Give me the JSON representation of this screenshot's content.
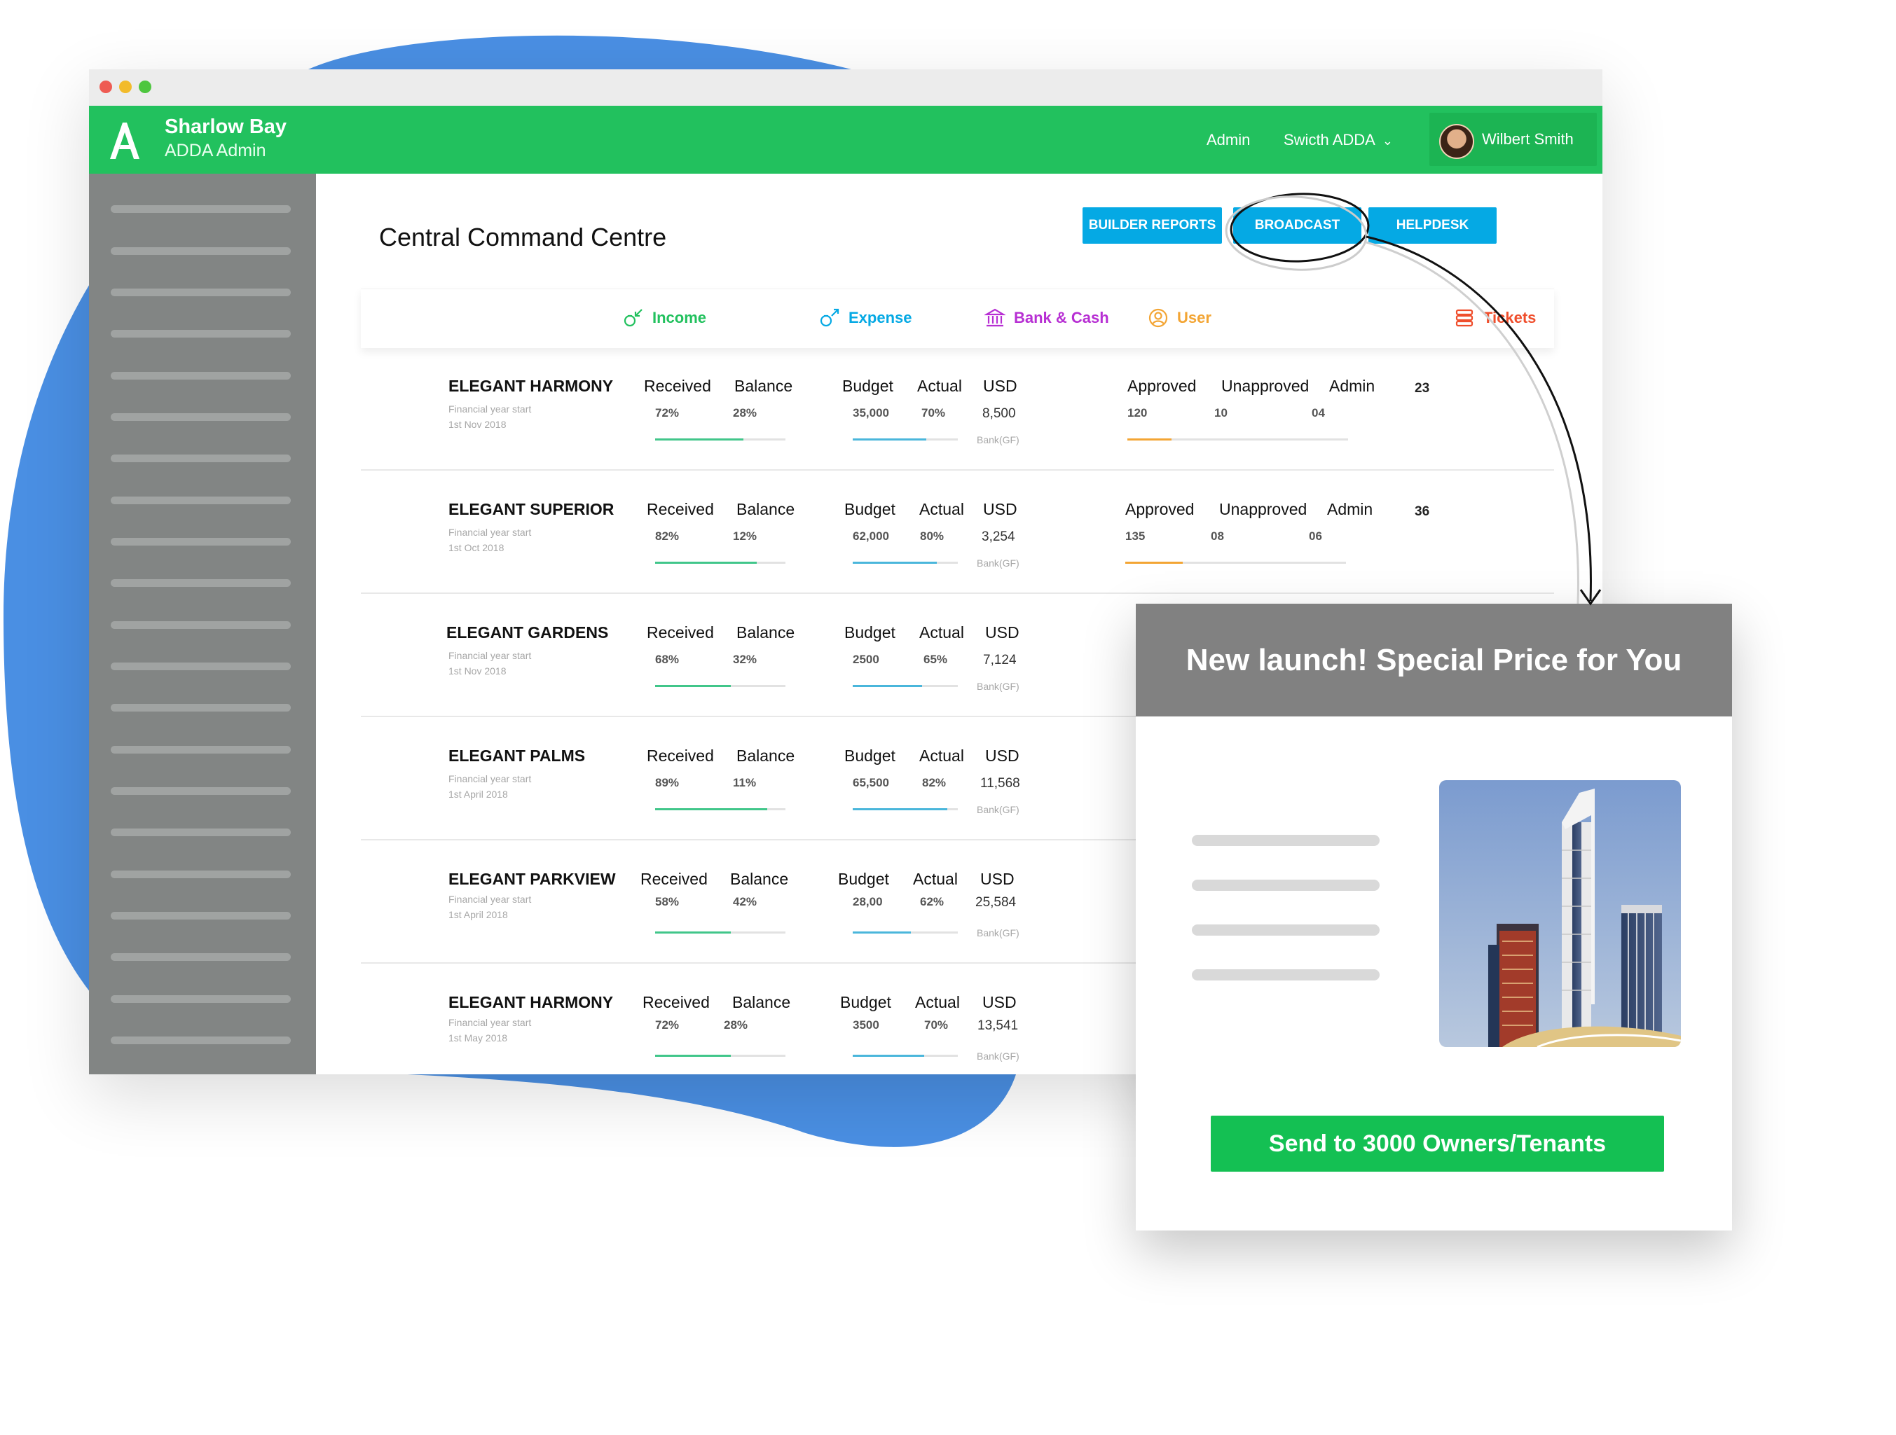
{
  "appbar": {
    "brand_name": "Sharlow Bay",
    "brand_sub": "ADDA Admin",
    "nav_admin": "Admin",
    "nav_switch": "Swicth ADDA",
    "user_name": "Wilbert Smith"
  },
  "page": {
    "title": "Central Command Centre",
    "buttons": [
      "BUILDER REPORTS",
      "BROADCAST",
      "HELPDESK"
    ]
  },
  "tabs": [
    {
      "label": "Income",
      "color": "#22c15e",
      "icon": "income-icon"
    },
    {
      "label": "Expense",
      "color": "#05a9e4",
      "icon": "expense-icon"
    },
    {
      "label": "Bank & Cash",
      "color": "#b72fd3",
      "icon": "bank-icon"
    },
    {
      "label": "User",
      "color": "#f3a534",
      "icon": "user-icon"
    },
    {
      "label": "Tickets",
      "color": "#ef4e2c",
      "icon": "tickets-icon"
    }
  ],
  "labels": {
    "financial_year": "Financial year start",
    "received": "Received",
    "balance": "Balance",
    "budget": "Budget",
    "actual": "Actual",
    "usd": "USD",
    "bank_gf": "Bank(GF)",
    "approved": "Approved",
    "unapproved": "Unapproved",
    "admin": "Admin"
  },
  "rows": [
    {
      "name": "ELEGANT HARMONY",
      "fy_date": "1st Nov 2018",
      "received": "72%",
      "balance": "28%",
      "received_ratio": 0.68,
      "budget": "35,000",
      "actual": "70%",
      "actual_ratio": 0.7,
      "usd": "8,500",
      "approved": "120",
      "unapproved": "10",
      "admin": "04",
      "tickets": "23",
      "approved_ratio": 0.2
    },
    {
      "name": "ELEGANT SUPERIOR",
      "fy_date": "1st Oct 2018",
      "received": "82%",
      "balance": "12%",
      "received_ratio": 0.78,
      "budget": "62,000",
      "actual": "80%",
      "actual_ratio": 0.8,
      "usd": "3,254",
      "approved": "135",
      "unapproved": "08",
      "admin": "06",
      "tickets": "36",
      "approved_ratio": 0.26
    },
    {
      "name": "ELEGANT GARDENS",
      "fy_date": "1st Nov 2018",
      "received": "68%",
      "balance": "32%",
      "received_ratio": 0.58,
      "budget": "2500",
      "actual": "65%",
      "actual_ratio": 0.66
    },
    {
      "name": "ELEGANT PALMS",
      "fy_date": "1st April 2018",
      "received": "89%",
      "balance": "11%",
      "received_ratio": 0.86,
      "budget": "65,500",
      "actual": "82%",
      "actual_ratio": 0.9,
      "usd": "11,568"
    },
    {
      "name": "ELEGANT PARKVIEW",
      "fy_date": "1st April 2018",
      "received": "58%",
      "balance": "42%",
      "received_ratio": 0.58,
      "budget": "28,00",
      "actual": "62%",
      "actual_ratio": 0.55,
      "usd": "25,584"
    },
    {
      "name": "ELEGANT HARMONY",
      "fy_date": "1st May 2018",
      "received": "72%",
      "balance": "28%",
      "received_ratio": 0.58,
      "budget": "3500",
      "actual": "70%",
      "actual_ratio": 0.68,
      "usd": "13,541"
    }
  ],
  "rows_usd_hidden": [
    "7,124"
  ],
  "popup": {
    "title": "New launch! Special Price for You",
    "send_label": "Send to 3000 Owners/Tenants"
  },
  "colors": {
    "brand_green": "#22c15e",
    "accent_blue": "#05a9e4",
    "sidebar_grey": "#828584",
    "popup_header": "#818181"
  }
}
